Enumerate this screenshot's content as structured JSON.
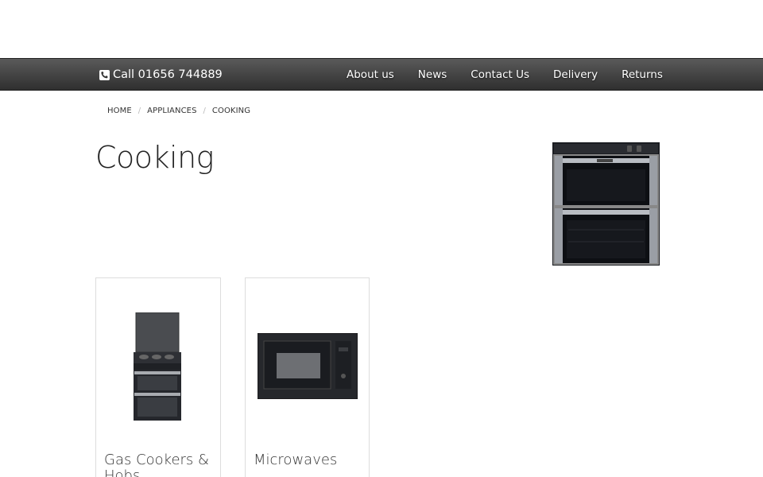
{
  "header": {
    "phone_label": "Call 01656 744889",
    "phone_icon": "phone-icon",
    "menu": [
      {
        "label": "About us"
      },
      {
        "label": "News"
      },
      {
        "label": "Contact Us"
      },
      {
        "label": "Delivery"
      },
      {
        "label": "Returns"
      }
    ]
  },
  "breadcrumb": {
    "items": [
      "HOME",
      "APPLIANCES",
      "COOKING"
    ],
    "separator": "/"
  },
  "page": {
    "title": "Cooking"
  },
  "categories": [
    {
      "title": "Gas Cookers & Hobs"
    },
    {
      "title": "Microwaves"
    }
  ],
  "colors": {
    "navbar_top": "#5a5a5a",
    "navbar_bottom": "#2f2f2f",
    "nav_text": "#ffffff"
  }
}
